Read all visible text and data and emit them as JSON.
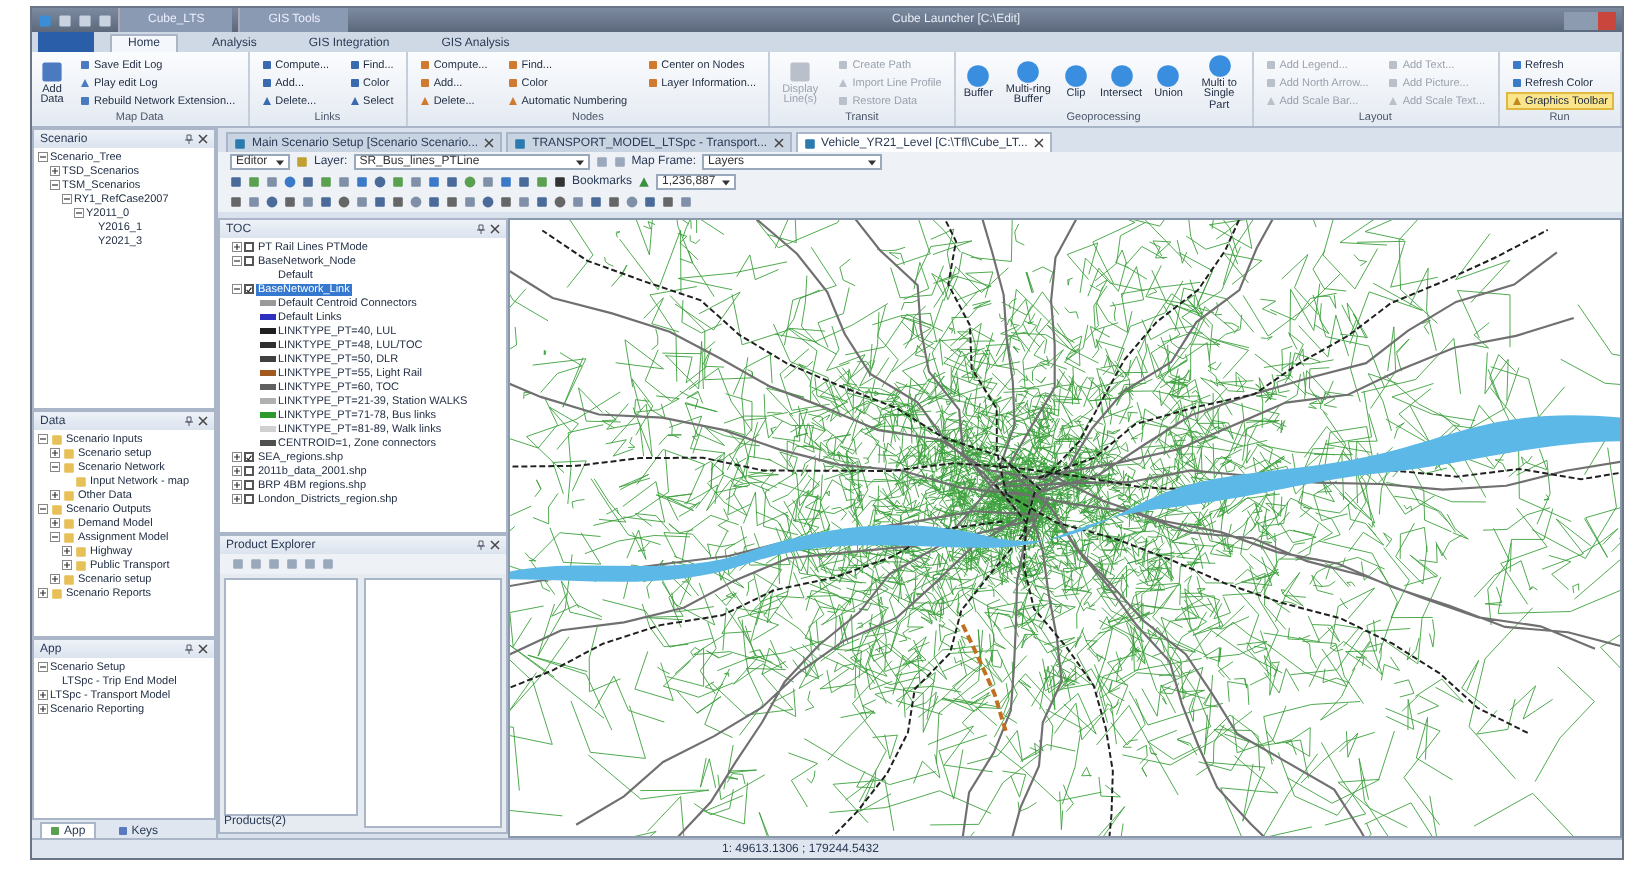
{
  "window": {
    "title": "Cube Launcher [C:\\Edit]"
  },
  "context_tabs": [
    {
      "label": "Cube_LTS"
    },
    {
      "label": "GIS Tools"
    }
  ],
  "ribbon_tabs": [
    {
      "label": "Home",
      "selected": true
    },
    {
      "label": "Analysis",
      "selected": false
    },
    {
      "label": "GIS Integration",
      "selected": false
    },
    {
      "label": "GIS Analysis",
      "selected": false
    }
  ],
  "ribbon_groups": [
    {
      "label": "Map Data",
      "disabled": false,
      "buttons": [
        {
          "kind": "large",
          "label": "Add Data"
        },
        {
          "kind": "small",
          "label": "Save Edit Log"
        },
        {
          "kind": "small",
          "label": "Play edit Log"
        },
        {
          "kind": "small",
          "label": "Rebuild Network Extension..."
        }
      ]
    },
    {
      "label": "Links",
      "disabled": false,
      "buttons": [
        {
          "kind": "small",
          "label": "Compute..."
        },
        {
          "kind": "small",
          "label": "Add..."
        },
        {
          "kind": "small",
          "label": "Delete..."
        },
        {
          "kind": "small",
          "label": "Find..."
        },
        {
          "kind": "small",
          "label": "Color"
        },
        {
          "kind": "small",
          "label": "Select"
        }
      ]
    },
    {
      "label": "Nodes",
      "disabled": false,
      "buttons": [
        {
          "kind": "small",
          "label": "Compute..."
        },
        {
          "kind": "small",
          "label": "Add..."
        },
        {
          "kind": "small",
          "label": "Delete..."
        },
        {
          "kind": "small",
          "label": "Find..."
        },
        {
          "kind": "small",
          "label": "Color"
        },
        {
          "kind": "small",
          "label": "Automatic Numbering"
        },
        {
          "kind": "small",
          "label": "Center on Nodes"
        },
        {
          "kind": "small",
          "label": "Layer Information..."
        }
      ]
    },
    {
      "label": "Transit",
      "disabled": true,
      "buttons": [
        {
          "kind": "large",
          "label": "Display Line(s)"
        },
        {
          "kind": "small",
          "label": "Create Path"
        },
        {
          "kind": "small",
          "label": "Import Line Profile"
        },
        {
          "kind": "small",
          "label": "Restore Data"
        }
      ]
    },
    {
      "label": "Geoprocessing",
      "disabled": false,
      "buttons": [
        {
          "kind": "large",
          "label": "Buffer"
        },
        {
          "kind": "large",
          "label": "Multi-ring Buffer"
        },
        {
          "kind": "large",
          "label": "Clip"
        },
        {
          "kind": "large",
          "label": "Intersect"
        },
        {
          "kind": "large",
          "label": "Union"
        },
        {
          "kind": "large",
          "label": "Multi to Single Part"
        }
      ]
    },
    {
      "label": "Layout",
      "disabled": true,
      "buttons": [
        {
          "kind": "small",
          "label": "Add Legend..."
        },
        {
          "kind": "small",
          "label": "Add North Arrow..."
        },
        {
          "kind": "small",
          "label": "Add Scale Bar..."
        },
        {
          "kind": "small",
          "label": "Add Text..."
        },
        {
          "kind": "small",
          "label": "Add Picture..."
        },
        {
          "kind": "small",
          "label": "Add Scale Text..."
        }
      ]
    },
    {
      "label": "Run",
      "disabled": false,
      "buttons": [
        {
          "kind": "small",
          "label": "Refresh"
        },
        {
          "kind": "small",
          "label": "Refresh Color"
        },
        {
          "kind": "toggle",
          "label": "Graphics Toolbar",
          "on": true
        }
      ]
    }
  ],
  "scenario_panel": {
    "title": "Scenario",
    "tree": [
      {
        "label": "Scenario_Tree",
        "expanded": true,
        "children": [
          {
            "label": "TSD_Scenarios",
            "expanded": false
          },
          {
            "label": "TSM_Scenarios",
            "expanded": true,
            "children": [
              {
                "label": "RY1_RefCase2007",
                "expanded": true,
                "children": [
                  {
                    "label": "Y2011_0",
                    "expanded": true,
                    "children": [
                      {
                        "label": "Y2016_1"
                      },
                      {
                        "label": "Y2021_3"
                      }
                    ]
                  }
                ]
              }
            ]
          }
        ]
      }
    ]
  },
  "data_panel": {
    "title": "Data",
    "tree": [
      {
        "label": "Scenario Inputs",
        "expanded": true,
        "children": [
          {
            "label": "Scenario setup",
            "expanded": false
          },
          {
            "label": "Scenario Network",
            "expanded": true,
            "children": [
              {
                "label": "Input Network - map"
              }
            ]
          },
          {
            "label": "Other Data",
            "expanded": false
          }
        ]
      },
      {
        "label": "Scenario Outputs",
        "expanded": true,
        "children": [
          {
            "label": "Demand Model",
            "expanded": false
          },
          {
            "label": "Assignment Model",
            "expanded": true,
            "children": [
              {
                "label": "Highway",
                "expanded": false
              },
              {
                "label": "Public Transport",
                "expanded": false
              }
            ]
          },
          {
            "label": "Scenario setup",
            "expanded": false
          }
        ]
      },
      {
        "label": "Scenario Reports",
        "expanded": false
      }
    ]
  },
  "app_panel": {
    "title": "App",
    "tree": [
      {
        "label": "Scenario Setup",
        "expanded": true,
        "children": [
          {
            "label": "LTSpc - Trip End Model"
          }
        ]
      },
      {
        "label": "LTSpc - Transport Model",
        "expanded": false
      },
      {
        "label": "Scenario Reporting",
        "expanded": false
      }
    ]
  },
  "left_tabs": [
    {
      "label": "App",
      "selected": true
    },
    {
      "label": "Keys",
      "selected": false
    }
  ],
  "document_tabs": [
    {
      "label": "Main Scenario Setup [Scenario Scenario...",
      "selected": false
    },
    {
      "label": "TRANSPORT_MODEL_LTSpc - Transport...",
      "selected": false
    },
    {
      "label": "Vehicle_YR21_Level [C:\\Tfl\\Cube_LT...",
      "selected": true
    }
  ],
  "editor_toolbar": {
    "editor": "Editor",
    "layer_label": "Layer:",
    "layer": "SR_Bus_lines_PTLine",
    "frame_label": "Map Frame:",
    "frame": "Layers",
    "bookmarks": "Bookmarks",
    "scale": "1,236,887"
  },
  "toc": {
    "title": "TOC",
    "layers": [
      {
        "label": "PT Rail Lines PTMode",
        "checked": false,
        "selected": false
      },
      {
        "label": "BaseNetwork_Node",
        "checked": false,
        "selected": false,
        "legend": [
          {
            "label": "Default"
          }
        ]
      },
      {
        "label": "BaseNetwork_Link",
        "checked": true,
        "selected": true,
        "legend": [
          {
            "label": "Default Centroid Connectors",
            "color": "#9a9a9a"
          },
          {
            "label": "Default Links",
            "color": "#3030c0"
          },
          {
            "label": "LINKTYPE_PT=40, LUL",
            "color": "#202020"
          },
          {
            "label": "LINKTYPE_PT=48, LUL/TOC",
            "color": "#303030"
          },
          {
            "label": "LINKTYPE_PT=50, DLR",
            "color": "#404040"
          },
          {
            "label": "LINKTYPE_PT=55, Light Rail",
            "color": "#a05a20"
          },
          {
            "label": "LINKTYPE_PT=60, TOC",
            "color": "#606060"
          },
          {
            "label": "LINKTYPE_PT=21-39, Station WALKS",
            "color": "#b0b0b0"
          },
          {
            "label": "LINKTYPE_PT=71-78, Bus links",
            "color": "#2e9a2e"
          },
          {
            "label": "LINKTYPE_PT=81-89, Walk links",
            "color": "#d0d0d0"
          },
          {
            "label": "CENTROID=1, Zone connectors",
            "color": "#505050"
          }
        ]
      },
      {
        "label": "SEA_regions.shp",
        "checked": true,
        "selected": false
      },
      {
        "label": "2011b_data_2001.shp",
        "checked": false,
        "selected": false
      },
      {
        "label": "BRP 4BM regions.shp",
        "checked": false,
        "selected": false
      },
      {
        "label": "London_Districts_region.shp",
        "checked": false,
        "selected": false
      }
    ]
  },
  "product_explorer": {
    "title": "Product Explorer",
    "footer": "Products(2)"
  },
  "status_bar": {
    "coordinates": "1: 49613.1306 ; 179244.5432"
  }
}
